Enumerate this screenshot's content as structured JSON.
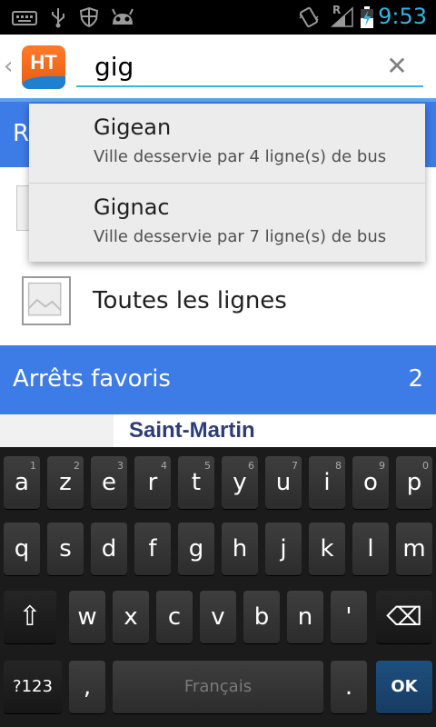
{
  "status_bar": {
    "icons": [
      "keyboard-icon",
      "usb-icon",
      "shield-icon",
      "android-icon",
      "vibrate-icon",
      "signal-icon",
      "battery-charging-icon"
    ],
    "roaming_letter": "R",
    "time": "9:53",
    "accent_color": "#33b5e5"
  },
  "action_bar": {
    "back_glyph": "‹",
    "logo_text": "HT",
    "search_value": "gig",
    "clear_glyph": "✕"
  },
  "suggestions": [
    {
      "name": "Gigean",
      "description": "Ville desservie par 4 ligne(s) de bus"
    },
    {
      "name": "Gignac",
      "description": "Ville desservie par 7 ligne(s) de bus"
    }
  ],
  "lines_section": {
    "header_letter": "R",
    "all_lines_label": "Toutes les lignes"
  },
  "favorites": {
    "header": "Arrêts favoris",
    "count": "2",
    "first_stop": "Saint-Martin",
    "header_color": "#3d7be6"
  },
  "keyboard": {
    "row1": [
      {
        "k": "a",
        "h": "1"
      },
      {
        "k": "z",
        "h": "2"
      },
      {
        "k": "e",
        "h": "3"
      },
      {
        "k": "r",
        "h": "4"
      },
      {
        "k": "t",
        "h": "5"
      },
      {
        "k": "y",
        "h": "6"
      },
      {
        "k": "u",
        "h": "7"
      },
      {
        "k": "i",
        "h": "8"
      },
      {
        "k": "o",
        "h": "9"
      },
      {
        "k": "p",
        "h": "0"
      }
    ],
    "row2": [
      "q",
      "s",
      "d",
      "f",
      "g",
      "h",
      "j",
      "k",
      "l",
      "m"
    ],
    "row3": [
      "w",
      "x",
      "c",
      "v",
      "b",
      "n",
      "'"
    ],
    "shift_glyph": "⇧",
    "delete_glyph": "⌫",
    "mode_label": "?123",
    "comma": ",",
    "space_label": "Français",
    "period": ".",
    "ok_label": "OK"
  }
}
